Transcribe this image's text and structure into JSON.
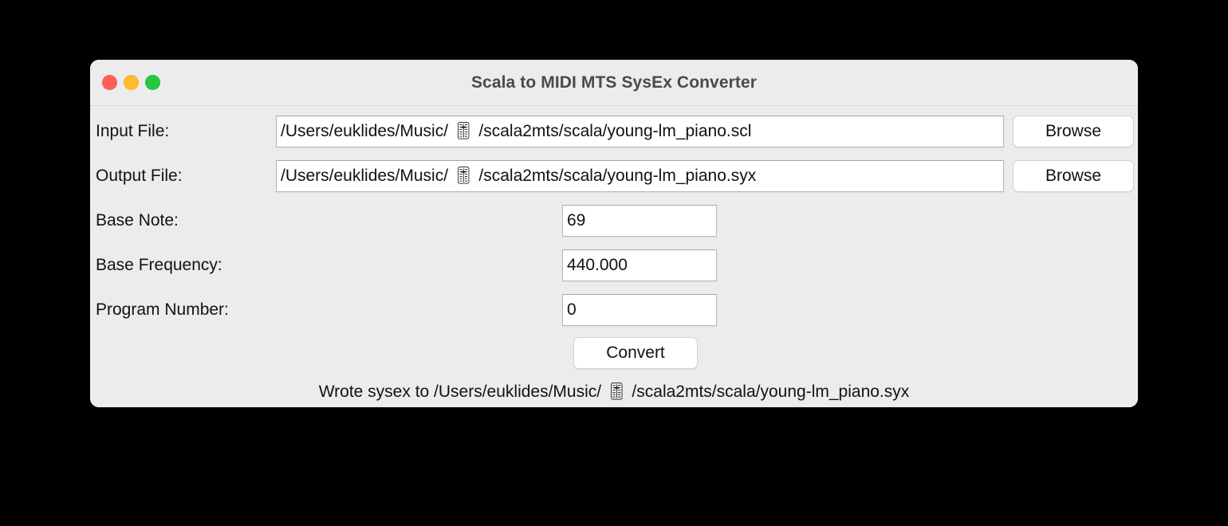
{
  "window": {
    "title": "Scala to MIDI MTS SysEx Converter",
    "traffic_lights": [
      {
        "name": "close",
        "color": "#ff5f57"
      },
      {
        "name": "minimize",
        "color": "#febc2e"
      },
      {
        "name": "maximize",
        "color": "#27c840"
      }
    ]
  },
  "form": {
    "input_file": {
      "label": "Input File:",
      "value": "/Users/euklides/Music/ 🎚 /scala2mts/scala/young-lm_piano.scl",
      "placeholder": "",
      "browse_label": "Browse"
    },
    "output_file": {
      "label": "Output File:",
      "value": "/Users/euklides/Music/ 🎚 /scala2mts/scala/young-lm_piano.syx",
      "placeholder": "",
      "browse_label": "Browse"
    },
    "base_note": {
      "label": "Base Note:",
      "value": "69",
      "placeholder": ""
    },
    "base_frequency": {
      "label": "Base Frequency:",
      "value": "440.000",
      "placeholder": ""
    },
    "program_number": {
      "label": "Program Number:",
      "value": "0",
      "placeholder": ""
    }
  },
  "actions": {
    "convert_label": "Convert"
  },
  "status": {
    "message": "Wrote sysex to /Users/euklides/Music/ 🎚 /scala2mts/scala/young-lm_piano.syx"
  },
  "colors": {
    "window_background": "#ececec",
    "titlebar_background": "#ececec",
    "title_text": "#4a4a4a",
    "field_background": "#ffffff",
    "field_border": "#b7b7b7",
    "button_background": "#ffffff",
    "text": "#121212",
    "desktop": "#000000"
  }
}
